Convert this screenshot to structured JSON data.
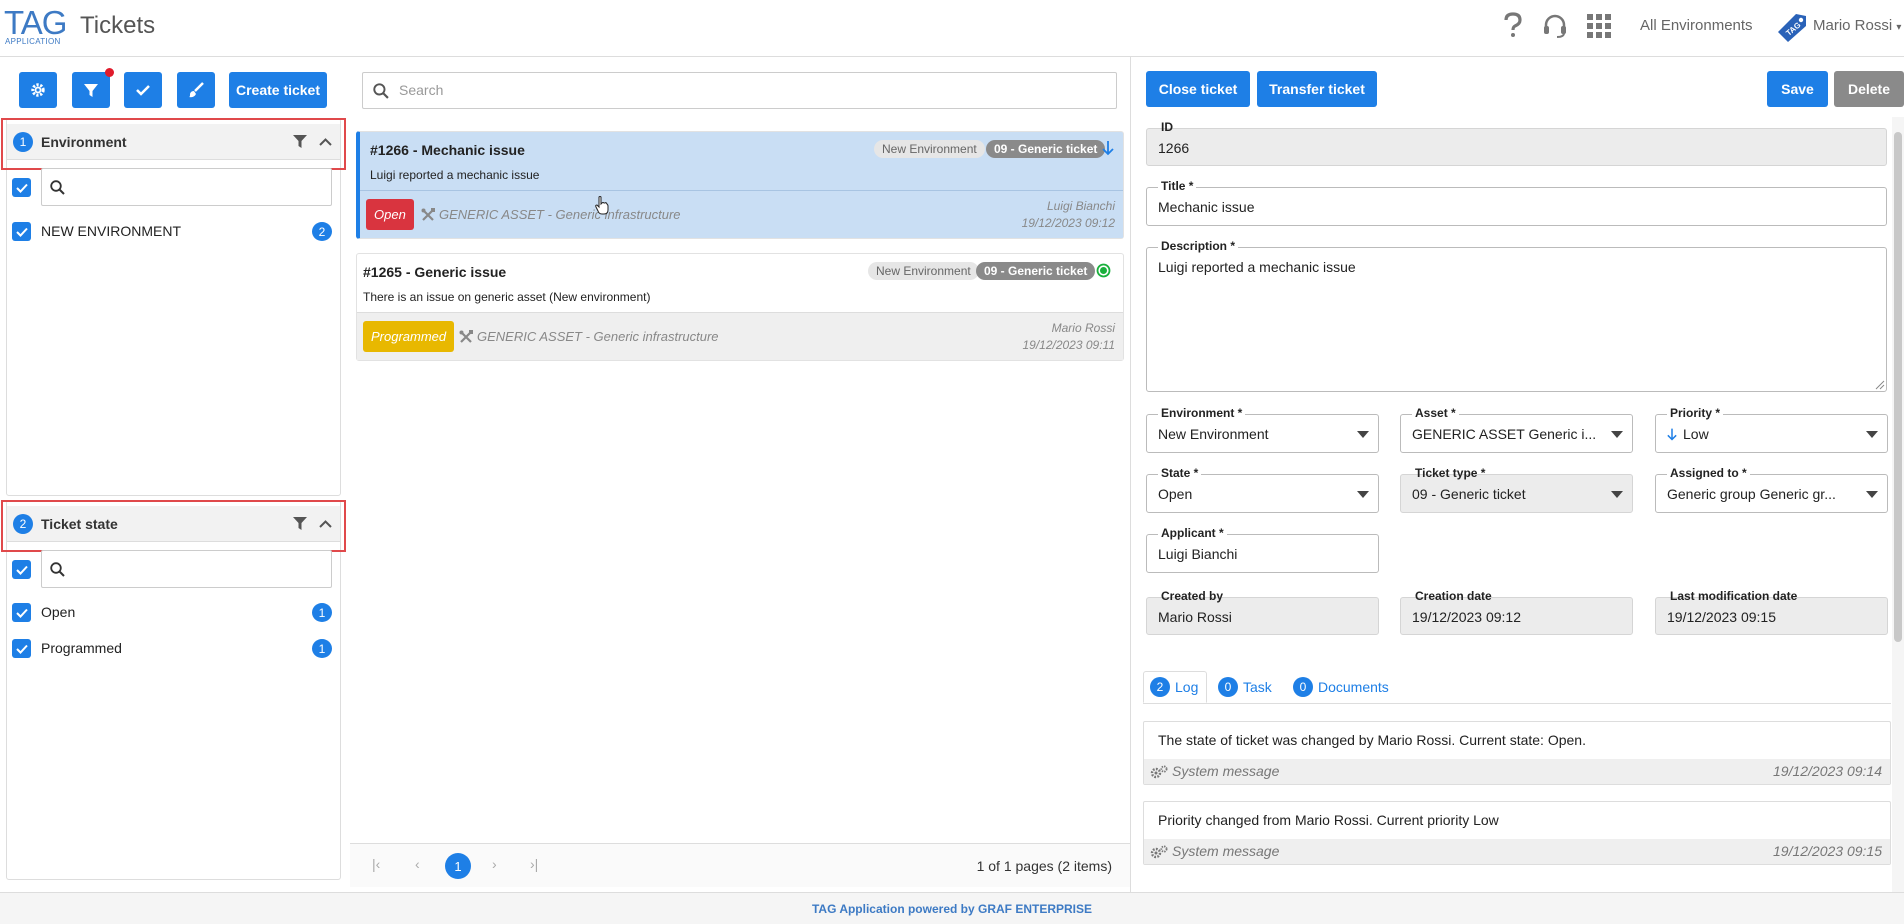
{
  "header": {
    "logo_big": "TAG",
    "logo_small": "APPLICATION",
    "title": "Tickets",
    "environment": "All Environments",
    "user": "Mario Rossi"
  },
  "toolbar": {
    "create_label": "Create ticket"
  },
  "filters": {
    "environment": {
      "index": "1",
      "title": "Environment",
      "items": [
        {
          "label": "NEW ENVIRONMENT",
          "count": "2"
        }
      ]
    },
    "state": {
      "index": "2",
      "title": "Ticket state",
      "items": [
        {
          "label": "Open",
          "count": "1"
        },
        {
          "label": "Programmed",
          "count": "1"
        }
      ]
    }
  },
  "search": {
    "placeholder": "Search"
  },
  "tickets": [
    {
      "title": "#1266 - Mechanic issue",
      "description": "Luigi reported a mechanic issue",
      "environment": "New Environment",
      "type": "09 - Generic ticket",
      "state": "Open",
      "state_color": "#d9343f",
      "asset": "GENERIC ASSET - Generic infrastructure",
      "user": "Luigi Bianchi",
      "date": "19/12/2023 09:12"
    },
    {
      "title": "#1265 - Generic issue",
      "description": "There is an issue on generic asset (New environment)",
      "environment": "New Environment",
      "type": "09 - Generic ticket",
      "state": "Programmed",
      "state_color": "#e8b800",
      "asset": "GENERIC ASSET - Generic infrastructure",
      "user": "Mario Rossi",
      "date": "19/12/2023 09:11"
    }
  ],
  "pager": {
    "current": "1",
    "info": "1 of 1 pages (2 items)"
  },
  "detail": {
    "close_label": "Close ticket",
    "transfer_label": "Transfer ticket",
    "save_label": "Save",
    "delete_label": "Delete",
    "fields": {
      "id": {
        "label": "ID",
        "value": "1266"
      },
      "title": {
        "label": "Title *",
        "value": "Mechanic issue"
      },
      "description": {
        "label": "Description *",
        "value": "Luigi reported a mechanic issue"
      },
      "environment": {
        "label": "Environment *",
        "value": "New Environment"
      },
      "asset": {
        "label": "Asset *",
        "value": "GENERIC ASSET Generic i..."
      },
      "priority": {
        "label": "Priority *",
        "value": "Low"
      },
      "state": {
        "label": "State *",
        "value": "Open"
      },
      "ticket_type": {
        "label": "Ticket type *",
        "value": "09 - Generic ticket"
      },
      "assigned_to": {
        "label": "Assigned to *",
        "value": "Generic group Generic gr..."
      },
      "applicant": {
        "label": "Applicant *",
        "value": "Luigi Bianchi"
      },
      "created_by": {
        "label": "Created by",
        "value": "Mario Rossi"
      },
      "creation_date": {
        "label": "Creation date",
        "value": "19/12/2023 09:12"
      },
      "last_mod": {
        "label": "Last modification date",
        "value": "19/12/2023 09:15"
      }
    },
    "tabs": [
      {
        "count": "2",
        "label": "Log"
      },
      {
        "count": "0",
        "label": "Task"
      },
      {
        "count": "0",
        "label": "Documents"
      }
    ],
    "logs": [
      {
        "text": "The state of ticket was changed by Mario Rossi. Current state: Open.",
        "source": "System message",
        "date": "19/12/2023 09:14"
      },
      {
        "text": "Priority changed from Mario Rossi. Current priority Low",
        "source": "System message",
        "date": "19/12/2023 09:15"
      }
    ]
  },
  "footer": {
    "text": "TAG Application powered by GRAF ENTERPRISE"
  },
  "colors": {
    "primary": "#1e7fe6",
    "highlight": "#e0494b"
  }
}
